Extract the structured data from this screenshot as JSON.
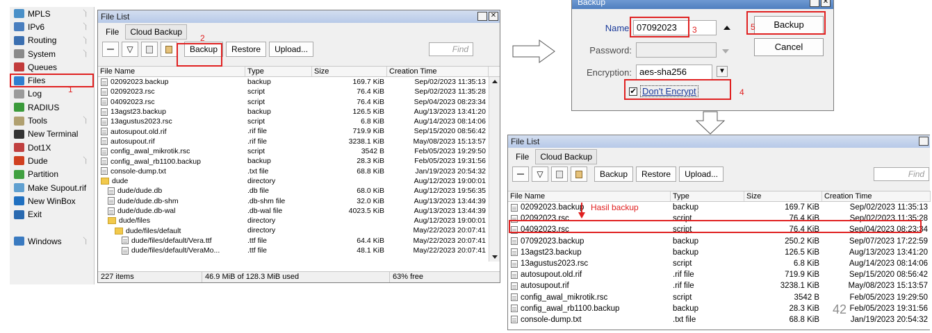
{
  "sidebar": {
    "items": [
      {
        "label": "MPLS",
        "icon": "mpls-icon",
        "submenu": true,
        "color": "#4a90c8"
      },
      {
        "label": "IPv6",
        "icon": "ipv6-icon",
        "submenu": true,
        "color": "#4a7fbf"
      },
      {
        "label": "Routing",
        "icon": "routing-icon",
        "submenu": true,
        "color": "#3b6fb0"
      },
      {
        "label": "System",
        "icon": "system-icon",
        "submenu": true,
        "color": "#8a8a8a"
      },
      {
        "label": "Queues",
        "icon": "queues-icon",
        "submenu": false,
        "color": "#c23b3b"
      },
      {
        "label": "Files",
        "icon": "files-icon",
        "submenu": false,
        "color": "#2f7fd0",
        "selected": true
      },
      {
        "label": "Log",
        "icon": "log-icon",
        "submenu": false,
        "color": "#9a9a9a"
      },
      {
        "label": "RADIUS",
        "icon": "radius-icon",
        "submenu": false,
        "color": "#3a9a3a"
      },
      {
        "label": "Tools",
        "icon": "tools-icon",
        "submenu": true,
        "color": "#b0a070"
      },
      {
        "label": "New Terminal",
        "icon": "terminal-icon",
        "submenu": false,
        "color": "#333333"
      },
      {
        "label": "Dot1X",
        "icon": "dot1x-icon",
        "submenu": false,
        "color": "#c04040"
      },
      {
        "label": "Dude",
        "icon": "dude-icon",
        "submenu": true,
        "color": "#d04020"
      },
      {
        "label": "Partition",
        "icon": "partition-icon",
        "submenu": false,
        "color": "#40a040"
      },
      {
        "label": "Make Supout.rif",
        "icon": "supout-icon",
        "submenu": false,
        "color": "#60a0d0"
      },
      {
        "label": "New WinBox",
        "icon": "winbox-icon",
        "submenu": false,
        "color": "#2070c0"
      },
      {
        "label": "Exit",
        "icon": "exit-icon",
        "submenu": false,
        "color": "#2a6ab0"
      },
      {
        "label": "",
        "icon": "",
        "submenu": false,
        "color": ""
      },
      {
        "label": "Windows",
        "icon": "windows-icon",
        "submenu": true,
        "color": "#3a7ac0"
      }
    ],
    "annotation": "1"
  },
  "filelist1": {
    "title": "File List",
    "tabs": [
      "File",
      "Cloud Backup"
    ],
    "buttons": {
      "backup": "Backup",
      "restore": "Restore",
      "upload": "Upload..."
    },
    "find_placeholder": "Find",
    "annotation": "2",
    "columns": [
      "File Name",
      "Type",
      "Size",
      "Creation Time"
    ],
    "rows": [
      {
        "name": "02092023.backup",
        "type": "backup",
        "size": "169.7 KiB",
        "time": "Sep/02/2023 11:35:13",
        "kind": "file",
        "indent": 0
      },
      {
        "name": "02092023.rsc",
        "type": "script",
        "size": "76.4 KiB",
        "time": "Sep/02/2023 11:35:28",
        "kind": "file",
        "indent": 0
      },
      {
        "name": "04092023.rsc",
        "type": "script",
        "size": "76.4 KiB",
        "time": "Sep/04/2023 08:23:34",
        "kind": "file",
        "indent": 0
      },
      {
        "name": "13agst23.backup",
        "type": "backup",
        "size": "126.5 KiB",
        "time": "Aug/13/2023 13:41:20",
        "kind": "file",
        "indent": 0
      },
      {
        "name": "13agustus2023.rsc",
        "type": "script",
        "size": "6.8 KiB",
        "time": "Aug/14/2023 08:14:06",
        "kind": "file",
        "indent": 0
      },
      {
        "name": "autosupout.old.rif",
        "type": ".rif file",
        "size": "719.9 KiB",
        "time": "Sep/15/2020 08:56:42",
        "kind": "file",
        "indent": 0
      },
      {
        "name": "autosupout.rif",
        "type": ".rif file",
        "size": "3238.1 KiB",
        "time": "May/08/2023 15:13:57",
        "kind": "file",
        "indent": 0
      },
      {
        "name": "config_awal_mikrotik.rsc",
        "type": "script",
        "size": "3542 B",
        "time": "Feb/05/2023 19:29:50",
        "kind": "file",
        "indent": 0
      },
      {
        "name": "config_awal_rb1100.backup",
        "type": "backup",
        "size": "28.3 KiB",
        "time": "Feb/05/2023 19:31:56",
        "kind": "file",
        "indent": 0
      },
      {
        "name": "console-dump.txt",
        "type": ".txt file",
        "size": "68.8 KiB",
        "time": "Jan/19/2023 20:54:32",
        "kind": "file",
        "indent": 0
      },
      {
        "name": "dude",
        "type": "directory",
        "size": "",
        "time": "Aug/12/2023 19:00:01",
        "kind": "dir",
        "indent": 0
      },
      {
        "name": "dude/dude.db",
        "type": ".db file",
        "size": "68.0 KiB",
        "time": "Aug/12/2023 19:56:35",
        "kind": "file",
        "indent": 1
      },
      {
        "name": "dude/dude.db-shm",
        "type": ".db-shm file",
        "size": "32.0 KiB",
        "time": "Aug/13/2023 13:44:39",
        "kind": "file",
        "indent": 1
      },
      {
        "name": "dude/dude.db-wal",
        "type": ".db-wal file",
        "size": "4023.5 KiB",
        "time": "Aug/13/2023 13:44:39",
        "kind": "file",
        "indent": 1
      },
      {
        "name": "dude/files",
        "type": "directory",
        "size": "",
        "time": "Aug/12/2023 19:00:01",
        "kind": "dir",
        "indent": 1
      },
      {
        "name": "dude/files/default",
        "type": "directory",
        "size": "",
        "time": "May/22/2023 20:07:41",
        "kind": "dir",
        "indent": 2
      },
      {
        "name": "dude/files/default/Vera.ttf",
        "type": ".ttf file",
        "size": "64.4 KiB",
        "time": "May/22/2023 20:07:41",
        "kind": "file",
        "indent": 3
      },
      {
        "name": "dude/files/default/VeraMo...",
        "type": ".ttf file",
        "size": "48.1 KiB",
        "time": "May/22/2023 20:07:41",
        "kind": "file",
        "indent": 3
      }
    ],
    "status": {
      "items": "227 items",
      "used": "46.9 MiB of 128.3 MiB used",
      "free": "63% free"
    }
  },
  "dialog": {
    "title": "Backup",
    "name_label": "Name:",
    "name_value": "07092023",
    "password_label": "Password:",
    "encryption_label": "Encryption:",
    "encryption_value": "aes-sha256",
    "dont_encrypt": "Don't Encrypt",
    "dont_encrypt_checked": true,
    "backup_button": "Backup",
    "cancel_button": "Cancel",
    "annotations": {
      "name": "3",
      "backup": "5",
      "dont_encrypt": "4"
    }
  },
  "filelist2": {
    "title": "File List",
    "tabs": [
      "File",
      "Cloud Backup"
    ],
    "buttons": {
      "backup": "Backup",
      "restore": "Restore",
      "upload": "Upload..."
    },
    "find_placeholder": "Find",
    "columns": [
      "File Name",
      "Type",
      "Size",
      "Creation Time"
    ],
    "annotation": "Hasil backup",
    "page_number": "42",
    "rows": [
      {
        "name": "02092023.backup",
        "type": "backup",
        "size": "169.7 KiB",
        "time": "Sep/02/2023 11:35:13"
      },
      {
        "name": "02092023.rsc",
        "type": "script",
        "size": "76.4 KiB",
        "time": "Sep/02/2023 11:35:28"
      },
      {
        "name": "04092023.rsc",
        "type": "script",
        "size": "76.4 KiB",
        "time": "Sep/04/2023 08:23:34"
      },
      {
        "name": "07092023.backup",
        "type": "backup",
        "size": "250.2 KiB",
        "time": "Sep/07/2023 17:22:59",
        "highlight": true
      },
      {
        "name": "13agst23.backup",
        "type": "backup",
        "size": "126.5 KiB",
        "time": "Aug/13/2023 13:41:20"
      },
      {
        "name": "13agustus2023.rsc",
        "type": "script",
        "size": "6.8 KiB",
        "time": "Aug/14/2023 08:14:06"
      },
      {
        "name": "autosupout.old.rif",
        "type": ".rif file",
        "size": "719.9 KiB",
        "time": "Sep/15/2020 08:56:42"
      },
      {
        "name": "autosupout.rif",
        "type": ".rif file",
        "size": "3238.1 KiB",
        "time": "May/08/2023 15:13:57"
      },
      {
        "name": "config_awal_mikrotik.rsc",
        "type": "script",
        "size": "3542 B",
        "time": "Feb/05/2023 19:29:50"
      },
      {
        "name": "config_awal_rb1100.backup",
        "type": "backup",
        "size": "28.3 KiB",
        "time": "Feb/05/2023 19:31:56"
      },
      {
        "name": "console-dump.txt",
        "type": ".txt file",
        "size": "68.8 KiB",
        "time": "Jan/19/2023 20:54:32"
      }
    ]
  }
}
